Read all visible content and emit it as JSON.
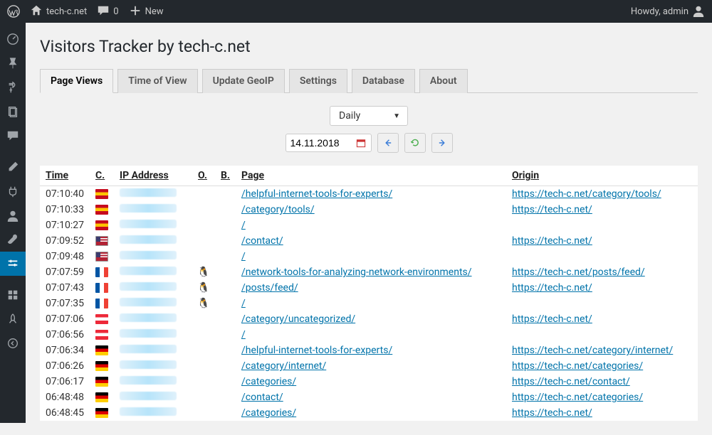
{
  "adminbar": {
    "site_name": "tech-c.net",
    "comments_count": "0",
    "new_label": "New",
    "howdy": "Howdy, admin"
  },
  "page_title": "Visitors Tracker by tech-c.net",
  "tabs": [
    {
      "label": "Page Views",
      "active": true
    },
    {
      "label": "Time of View",
      "active": false
    },
    {
      "label": "Update GeoIP",
      "active": false
    },
    {
      "label": "Settings",
      "active": false
    },
    {
      "label": "Database",
      "active": false
    },
    {
      "label": "About",
      "active": false
    }
  ],
  "controls": {
    "period": "Daily",
    "date": "14.11.2018"
  },
  "headers": {
    "time": "Time",
    "c": "C.",
    "ip": "IP Address",
    "o": "O.",
    "b": "B.",
    "page": "Page",
    "origin": "Origin"
  },
  "rows": [
    {
      "time": "07:10:40",
      "flag": "es",
      "os": "world",
      "browser": "ff",
      "page": "/helpful-internet-tools-for-experts/",
      "origin": "https://tech-c.net/category/tools/"
    },
    {
      "time": "07:10:33",
      "flag": "es",
      "os": "world",
      "browser": "ff",
      "page": "/category/tools/",
      "origin": "https://tech-c.net/"
    },
    {
      "time": "07:10:27",
      "flag": "es",
      "os": "world",
      "browser": "ff",
      "page": "/",
      "origin": ""
    },
    {
      "time": "07:09:52",
      "flag": "us",
      "os": "win",
      "browser": "chrome",
      "page": "/contact/",
      "origin": "https://tech-c.net/"
    },
    {
      "time": "07:09:48",
      "flag": "us",
      "os": "win",
      "browser": "chrome",
      "page": "/",
      "origin": ""
    },
    {
      "time": "07:07:59",
      "flag": "fr",
      "os": "linux",
      "browser": "ie",
      "page": "/network-tools-for-analyzing-network-environments/",
      "origin": "https://tech-c.net/posts/feed/"
    },
    {
      "time": "07:07:43",
      "flag": "fr",
      "os": "linux",
      "browser": "ie",
      "page": "/posts/feed/",
      "origin": "https://tech-c.net/"
    },
    {
      "time": "07:07:35",
      "flag": "fr",
      "os": "linux",
      "browser": "ie",
      "page": "/",
      "origin": ""
    },
    {
      "time": "07:07:06",
      "flag": "at",
      "os": "winvista",
      "browser": "sf",
      "page": "/category/uncategorized/",
      "origin": "https://tech-c.net/"
    },
    {
      "time": "07:06:56",
      "flag": "at",
      "os": "winvista",
      "browser": "sf",
      "page": "/",
      "origin": ""
    },
    {
      "time": "07:06:34",
      "flag": "de",
      "os": "winvista",
      "browser": "ff",
      "page": "/helpful-internet-tools-for-experts/",
      "origin": "https://tech-c.net/category/internet/"
    },
    {
      "time": "07:06:26",
      "flag": "de",
      "os": "winvista",
      "browser": "ff",
      "page": "/category/internet/",
      "origin": "https://tech-c.net/categories/"
    },
    {
      "time": "07:06:17",
      "flag": "de",
      "os": "winvista",
      "browser": "ff",
      "page": "/categories/",
      "origin": "https://tech-c.net/contact/"
    },
    {
      "time": "06:48:48",
      "flag": "de",
      "os": "winvista",
      "browser": "ff",
      "page": "/contact/",
      "origin": "https://tech-c.net/categories/"
    },
    {
      "time": "06:48:45",
      "flag": "de",
      "os": "winvista",
      "browser": "ff",
      "page": "/categories/",
      "origin": "https://tech-c.net/"
    }
  ]
}
